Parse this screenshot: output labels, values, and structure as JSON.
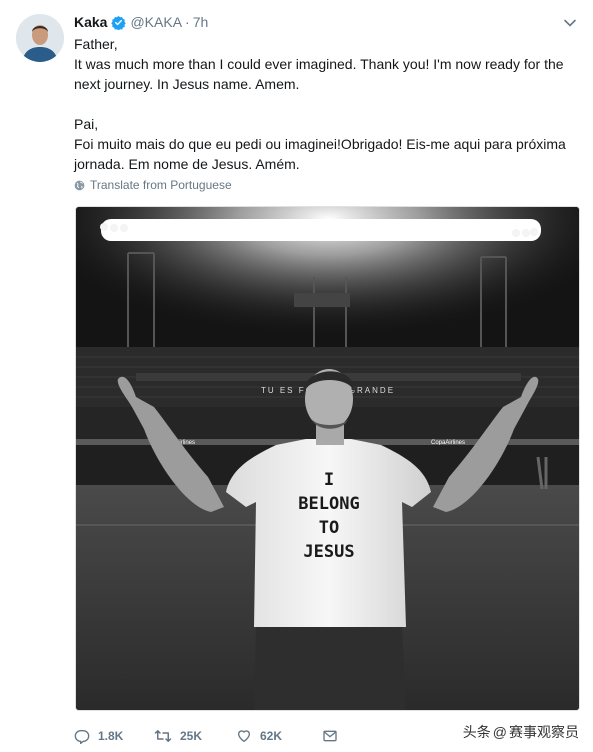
{
  "tweet": {
    "author_name": "Kaka",
    "handle": "@KAKA",
    "separator": "·",
    "time": "7h",
    "paragraphs_en": [
      "Father,",
      "It was much more than I could ever imagined. Thank you! I'm now ready for the",
      "next journey. In Jesus name. Amem."
    ],
    "paragraphs_pt": [
      "Pai,",
      "Foi muito mais do que eu pedi ou imaginei!Obrigado! Eis-me aqui para próxima",
      "jornada. Em nome de Jesus. Amém."
    ],
    "translate_label": "Translate from Portuguese"
  },
  "media": {
    "banner_text": "TU ES FORTE · GRANDE",
    "sponsor_left": "CopaAirlines",
    "sponsor_right": "CopaAirlines",
    "shirt_lines": [
      "I",
      "BELONG",
      "TO",
      "JESUS"
    ]
  },
  "actions": {
    "reply_count": "1.8K",
    "retweet_count": "25K",
    "like_count": "62K"
  },
  "watermark": {
    "left": "头条",
    "at": "@",
    "right": "赛事观察员"
  },
  "colors": {
    "verified": "#1da1f2",
    "muted": "#657786",
    "text": "#14171a"
  }
}
